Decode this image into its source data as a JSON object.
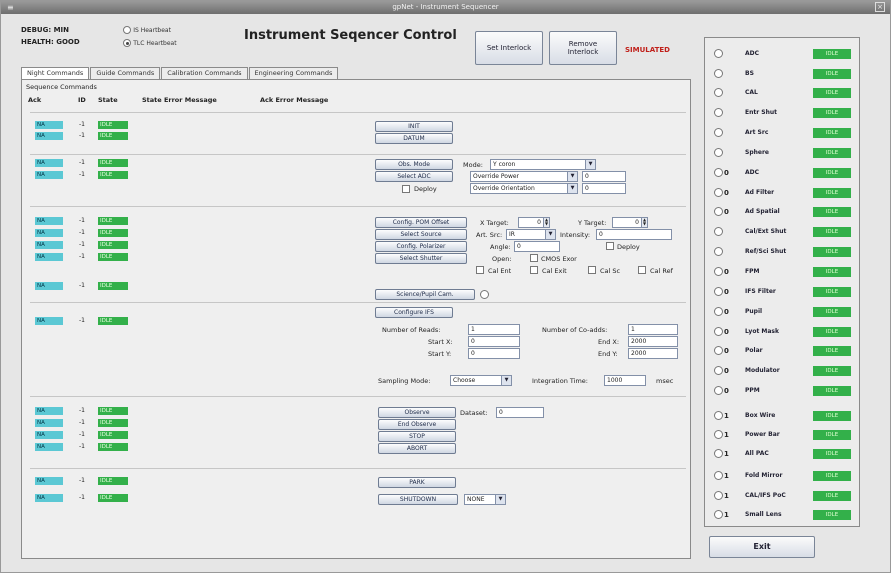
{
  "window": {
    "title": "gpNet - Instrument Sequencer",
    "menu_glyph": "≡",
    "close_glyph": "×"
  },
  "header": {
    "debug": "DEBUG: MIN",
    "health": "HEALTH: GOOD",
    "heartbeat_options": [
      {
        "label": "IS Heartbeat",
        "selected": false
      },
      {
        "label": "TLC Heartbeat",
        "selected": true
      }
    ],
    "title": "Instrument Seqencer Control",
    "set_interlock": "Set Interlock",
    "remove_interlock": "Remove\nInterlock",
    "simulated": "SIMULATED"
  },
  "tabs": [
    "Night Commands",
    "Guide Commands",
    "Calibration Commands",
    "Engineering Commands"
  ],
  "panel": {
    "title": "Sequence Commands",
    "col_ack": "Ack",
    "col_id": "ID",
    "col_state": "State",
    "col_state_err": "State Error Message",
    "col_ack_err": "Ack Error Message"
  },
  "rows_init": [
    {
      "ack": "NA",
      "id": "-1",
      "state": "IDLE"
    },
    {
      "ack": "NA",
      "id": "-1",
      "state": "IDLE"
    }
  ],
  "rows_obs": [
    {
      "ack": "NA",
      "id": "-1",
      "state": "IDLE"
    },
    {
      "ack": "NA",
      "id": "-1",
      "state": "IDLE"
    }
  ],
  "rows_config": [
    {
      "ack": "NA",
      "id": "-1",
      "state": "IDLE"
    },
    {
      "ack": "NA",
      "id": "-1",
      "state": "IDLE"
    },
    {
      "ack": "NA",
      "id": "-1",
      "state": "IDLE"
    },
    {
      "ack": "NA",
      "id": "-1",
      "state": "IDLE"
    }
  ],
  "rows_science": [
    {
      "ack": "NA",
      "id": "-1",
      "state": "IDLE"
    }
  ],
  "rows_ifs": [
    {
      "ack": "NA",
      "id": "-1",
      "state": "IDLE"
    }
  ],
  "rows_observe": [
    {
      "ack": "NA",
      "id": "-1",
      "state": "IDLE"
    },
    {
      "ack": "NA",
      "id": "-1",
      "state": "IDLE"
    },
    {
      "ack": "NA",
      "id": "-1",
      "state": "IDLE"
    },
    {
      "ack": "NA",
      "id": "-1",
      "state": "IDLE"
    }
  ],
  "rows_park": [
    {
      "ack": "NA",
      "id": "-1",
      "state": "IDLE"
    },
    {
      "ack": "NA",
      "id": "-1",
      "state": "IDLE"
    }
  ],
  "buttons": {
    "init": "INIT",
    "datum": "DATUM",
    "obs_mode": "Obs. Mode",
    "select_adc": "Select ADC",
    "config_pom": "Config. POM Offset",
    "select_source": "Select Source",
    "config_polarizer": "Config. Polarizer",
    "select_shutter": "Select Shutter",
    "science_pupil": "Science/Pupil Cam.",
    "configure_ifs": "Configure IFS",
    "observe": "Observe",
    "end_observe": "End Observe",
    "stop": "STOP",
    "abort": "ABORT",
    "park": "PARK",
    "shutdown": "SHUTDOWN"
  },
  "obs": {
    "mode_label": "Mode:",
    "mode_value": "Y coron",
    "adc_power": "Override Power",
    "adc_power_val": "0",
    "adc_orient": "Override Orientation",
    "adc_orient_val": "0",
    "deploy_label": "Deploy"
  },
  "config": {
    "xtarget_label": "X Target:",
    "xtarget_val": "0",
    "ytarget_label": "Y Target:",
    "ytarget_val": "0",
    "artsrc_label": "Art. Src:",
    "artsrc_val": "IR",
    "intensity_label": "Intensity:",
    "intensity_val": "0",
    "angle_label": "Angle:",
    "angle_val": "0",
    "deploy2_label": "Deploy",
    "open_label": "Open:",
    "cmos_label": "CMOS Exor",
    "cal_ent": "Cal Ent",
    "cal_exit": "Cal Exit",
    "cal_sc": "Cal Sc",
    "cal_ref": "Cal Ref"
  },
  "ifs": {
    "reads_label": "Number of Reads:",
    "reads_val": "1",
    "coadds_label": "Number of Co-adds:",
    "coadds_val": "1",
    "startx_label": "Start X:",
    "startx_val": "0",
    "endx_label": "End X:",
    "endx_val": "2000",
    "starty_label": "Start Y:",
    "starty_val": "0",
    "endy_label": "End Y:",
    "endy_val": "2000",
    "sampling_label": "Sampling Mode:",
    "sampling_val": "Choose",
    "integ_label": "Integration Time:",
    "integ_val": "1000",
    "integ_unit": "msec"
  },
  "observe": {
    "dataset_label": "Dataset:",
    "dataset_val": "0"
  },
  "park": {
    "shutdown_val": "NONE"
  },
  "sidebar": [
    {
      "flag": "",
      "name": "ADC",
      "status": "IDLE"
    },
    {
      "flag": "",
      "name": "BS",
      "status": "IDLE"
    },
    {
      "flag": "",
      "name": "CAL",
      "status": "IDLE"
    },
    {
      "flag": "",
      "name": "Entr Shut",
      "status": "IDLE"
    },
    {
      "flag": "",
      "name": "Art Src",
      "status": "IDLE"
    },
    {
      "flag": "",
      "name": "Sphere",
      "status": "IDLE"
    },
    {
      "flag": "0",
      "name": "ADC",
      "status": "IDLE"
    },
    {
      "flag": "0",
      "name": "Ad Filter",
      "status": "IDLE"
    },
    {
      "flag": "0",
      "name": "Ad Spatial",
      "status": "IDLE"
    },
    {
      "flag": "",
      "name": "Cal/Ext Shut",
      "status": "IDLE"
    },
    {
      "flag": "",
      "name": "Ref/Sci Shut",
      "status": "IDLE"
    },
    {
      "flag": "0",
      "name": "FPM",
      "status": "IDLE"
    },
    {
      "flag": "0",
      "name": "IFS Filter",
      "status": "IDLE"
    },
    {
      "flag": "0",
      "name": "Pupil",
      "status": "IDLE"
    },
    {
      "flag": "0",
      "name": "Lyot Mask",
      "status": "IDLE"
    },
    {
      "flag": "0",
      "name": "Polar",
      "status": "IDLE"
    },
    {
      "flag": "0",
      "name": "Modulator",
      "status": "IDLE"
    },
    {
      "flag": "0",
      "name": "PPM",
      "status": "IDLE"
    },
    {
      "flag": "1",
      "name": "Box Wire",
      "status": "IDLE"
    },
    {
      "flag": "1",
      "name": "Power Bar",
      "status": "IDLE"
    },
    {
      "flag": "1",
      "name": "All PAC",
      "status": "IDLE"
    },
    {
      "flag": "1",
      "name": "Fold Mirror",
      "status": "IDLE"
    },
    {
      "flag": "1",
      "name": "CAL/IFS PoC",
      "status": "IDLE"
    },
    {
      "flag": "1",
      "name": "Small Lens",
      "status": "IDLE"
    }
  ],
  "exit": "Exit"
}
